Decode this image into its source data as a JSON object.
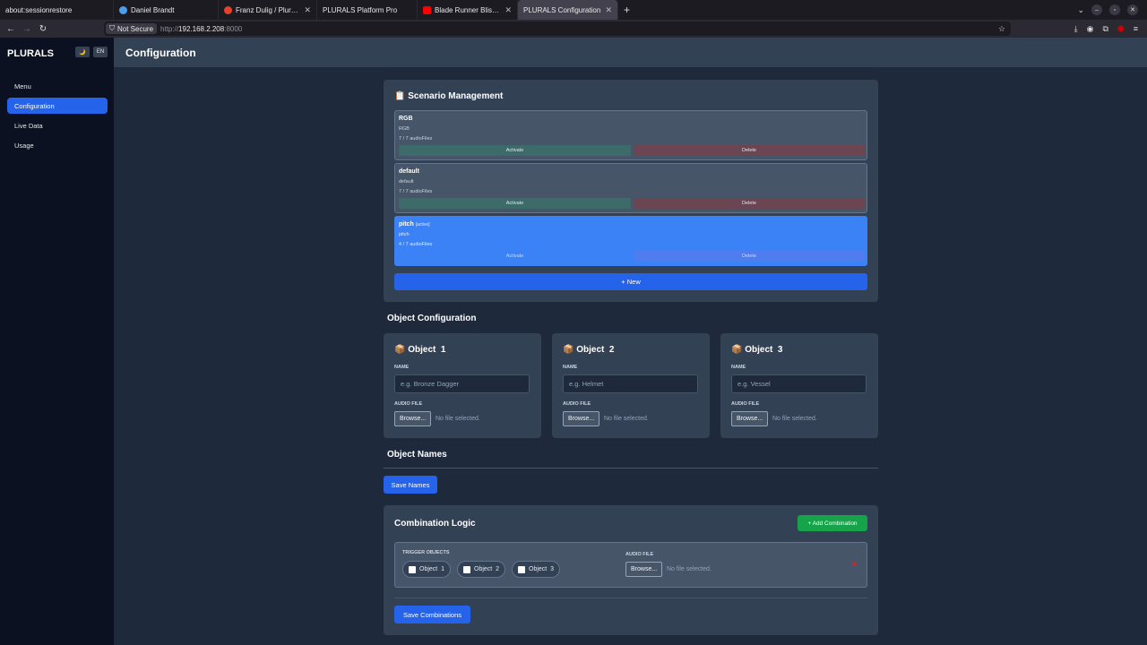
{
  "browser": {
    "tabs": [
      {
        "title": "about:sessionrestore",
        "icon_color": "#5b5b66"
      },
      {
        "title": "Daniel Brandt",
        "icon_color": "#4c9eea"
      },
      {
        "title": "Franz Dulig / Plurals_platf",
        "icon_color": "#e24329"
      },
      {
        "title": "PLURALS Platform Pro",
        "icon_color": ""
      },
      {
        "title": "Blade Runner Bliss: Pur",
        "icon_color": "#ff0000"
      },
      {
        "title": "PLURALS Configuration",
        "icon_color": ""
      }
    ],
    "new_tab_label": "+",
    "not_secure_label": "Not Secure",
    "url_prefix": "http://",
    "url_host": "192.168.2.208",
    "url_suffix": ":8000"
  },
  "sidebar": {
    "brand": "PLURALS",
    "theme_toggle": "🌙",
    "lang_toggle": "EN",
    "items": [
      {
        "label": "Menu",
        "active": false
      },
      {
        "label": "Configuration",
        "active": true
      },
      {
        "label": "Live Data",
        "active": false
      },
      {
        "label": "Usage",
        "active": false
      }
    ]
  },
  "header": {
    "title": "Configuration"
  },
  "scenarios": {
    "title": "📋 Scenario Management",
    "items": [
      {
        "name": "RGB",
        "tag": "",
        "desc": "RGB",
        "count": "7 / 7 audioFiles",
        "activate": "Activate",
        "delete": "Delete",
        "active": false
      },
      {
        "name": "default",
        "tag": "",
        "desc": "default",
        "count": "7 / 7 audioFiles",
        "activate": "Activate",
        "delete": "Delete",
        "active": false
      },
      {
        "name": "pitch",
        "tag": "[active]",
        "desc": "pitch",
        "count": "4 / 7 audioFiles",
        "activate": "Activate",
        "delete": "Delete",
        "active": true
      }
    ],
    "new_label": "+ New"
  },
  "object_config": {
    "title": "Object Configuration",
    "objects": [
      {
        "icon": "📦",
        "title": "Object  1",
        "name_label": "NAME",
        "placeholder": "e.g. Bronze Dagger",
        "audio_label": "AUDIO FILE",
        "browse": "Browse...",
        "nofile": "No file selected."
      },
      {
        "icon": "📦",
        "title": "Object  2",
        "name_label": "NAME",
        "placeholder": "e.g. Helmet",
        "audio_label": "AUDIO FILE",
        "browse": "Browse...",
        "nofile": "No file selected."
      },
      {
        "icon": "📦",
        "title": "Object  3",
        "name_label": "NAME",
        "placeholder": "e.g. Vessel",
        "audio_label": "AUDIO FILE",
        "browse": "Browse...",
        "nofile": "No file selected."
      }
    ]
  },
  "object_names": {
    "title": "Object Names",
    "save_label": "Save Names"
  },
  "combination": {
    "title": "Combination Logic",
    "add_label": "+ Add Combination",
    "trigger_label": "TRIGGER OBJECTS",
    "triggers": [
      "Object  1",
      "Object  2",
      "Object  3"
    ],
    "audio_label": "AUDIO FILE",
    "browse": "Browse...",
    "nofile": "No file selected.",
    "remove": "✕",
    "save_label": "Save Combinations"
  }
}
